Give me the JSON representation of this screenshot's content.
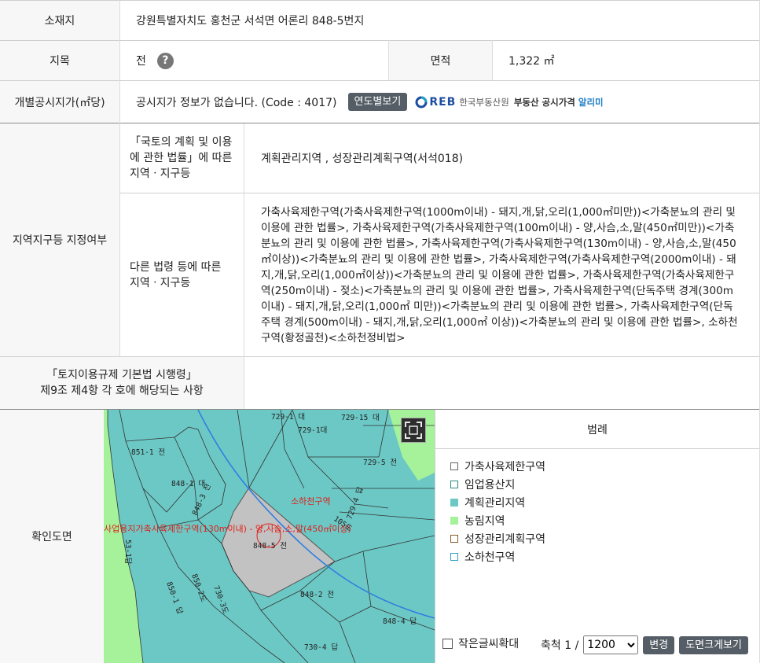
{
  "location": {
    "label": "소재지",
    "value": "강원특별자치도 홍천군 서석면 어론리 848-5번지"
  },
  "land_category": {
    "label": "지목",
    "value": "전",
    "help_icon": "?"
  },
  "area": {
    "label": "면적",
    "value": "1,322 ㎡"
  },
  "price": {
    "label": "개별공시지가(㎡당)",
    "value": "공시지가 정보가 없습니다. (Code : 4017)",
    "yearly_button": "연도별보기",
    "reb_logo": "REB",
    "reb_org": "한국부동산원",
    "reb_service": "부동산 공시가격",
    "reb_alimi": "알리미"
  },
  "zoning": {
    "label": "지역지구등 지정여부",
    "national_law_label": "「국토의 계획 및 이용에 관한 법률」에 따른 지역ㆍ지구등",
    "national_law_value": "계획관리지역 , 성장관리계획구역(서석018)",
    "other_law_label": "다른 법령 등에 따른 지역ㆍ지구등",
    "other_law_value": "가축사육제한구역(가축사육제한구역(1000m이내) - 돼지,개,닭,오리(1,000㎡미만))<가축분뇨의 관리 및 이용에 관한 법률>, 가축사육제한구역(가축사육제한구역(100m이내) - 양,사슴,소,말(450㎡미만))<가축분뇨의 관리 및 이용에 관한 법률>, 가축사육제한구역(가축사육제한구역(130m이내) - 양,사슴,소,말(450㎡이상))<가축분뇨의 관리 및 이용에 관한 법률>, 가축사육제한구역(가축사육제한구역(2000m이내) - 돼지,개,닭,오리(1,000㎡이상))<가축분뇨의 관리 및 이용에 관한 법률>, 가축사육제한구역(가축사육제한구역(250m이내) - 젖소)<가축분뇨의 관리 및 이용에 관한 법률>, 가축사육제한구역(단독주택 경계(300m이내) - 돼지,개,닭,오리(1,000㎡ 미만))<가축분뇨의 관리 및 이용에 관한 법률>, 가축사육제한구역(단독주택 경계(500m이내) - 돼지,개,닭,오리(1,000㎡ 이상))<가축분뇨의 관리 및 이용에 관한 법률>, 소하천구역(황정골천)<소하천정비법>"
  },
  "enforcement": {
    "label_line1": "「토지이용규제 기본법 시행령」",
    "label_line2": "제9조 제4항 각 호에 해당되는 사항",
    "value": ""
  },
  "map": {
    "label": "확인도면",
    "parcels": [
      "729-1대",
      "729-15 대",
      "729-5 전",
      "851-1 전",
      "848-1 대",
      "848-3 전",
      "848-5 전",
      "848-2 전",
      "848-4 답",
      "850-1 답",
      "850-2도",
      "730-4 답",
      "105도",
      "729-1 대",
      "53-1답",
      "730-3도"
    ],
    "overlay_text_1": "소하천구역",
    "overlay_text_2": "사업용지가축사육제한구역(130m이내) - 양,사슴,소,말(450㎡이상)",
    "colors": {
      "teal": "#6cc8c5",
      "green": "#a6f29a",
      "gray": "#c2c2c2",
      "red": "#e0201b",
      "blue": "#2f7fe0"
    }
  },
  "legend": {
    "title": "범례",
    "items": [
      {
        "label": "가축사육제한구역",
        "color": "#ffffff",
        "border": "#666666"
      },
      {
        "label": "임업용산지",
        "color": "#ffffff",
        "border": "#2a8a86"
      },
      {
        "label": "계획관리지역",
        "color": "#6cc8c5",
        "border": "#6cc8c5"
      },
      {
        "label": "농림지역",
        "color": "#a6f29a",
        "border": "#a6f29a"
      },
      {
        "label": "성장관리계획구역",
        "color": "#ffffff",
        "border": "#8a5a2a"
      },
      {
        "label": "소하천구역",
        "color": "#ffffff",
        "border": "#2a9ec8"
      }
    ],
    "small_text_label": "작은글씨확대",
    "scale_label": "축척 1 /",
    "scale_value": "1200",
    "change_button": "변경",
    "print_button": "도면크게보기"
  }
}
